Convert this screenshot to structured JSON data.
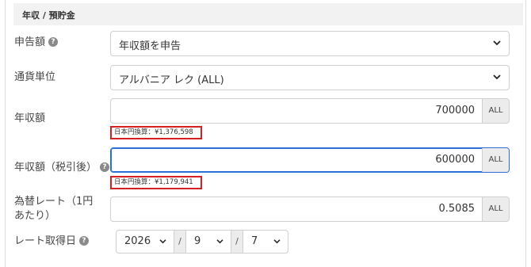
{
  "section": {
    "title": "年収 / 預貯金"
  },
  "declaration": {
    "label": "申告額",
    "selected": "年収額を申告"
  },
  "currency": {
    "label": "通貨単位",
    "selected": "アルバニア レク (ALL)"
  },
  "annual_income": {
    "label": "年収額",
    "value": "700000",
    "unit": "ALL",
    "jpy_note": "日本円換算：¥1,376,598"
  },
  "after_tax": {
    "label": "年収額（税引後）",
    "value": "600000",
    "unit": "ALL",
    "jpy_note": "日本円換算：¥1,179,941"
  },
  "rate": {
    "label": "為替レート（1円あたり）",
    "value": "0.5085",
    "unit": "ALL"
  },
  "rate_date": {
    "label": "レート取得日",
    "year": "2026",
    "month": "9",
    "day": "7",
    "separator": "/"
  },
  "help_glyph": "?",
  "icons": {
    "help": "question-circle-icon",
    "dropdown": "chevron-down-icon"
  },
  "colors": {
    "highlight": "#d61f1f",
    "focus": "#2a6fd6",
    "header_bg": "#f2f2f2"
  }
}
